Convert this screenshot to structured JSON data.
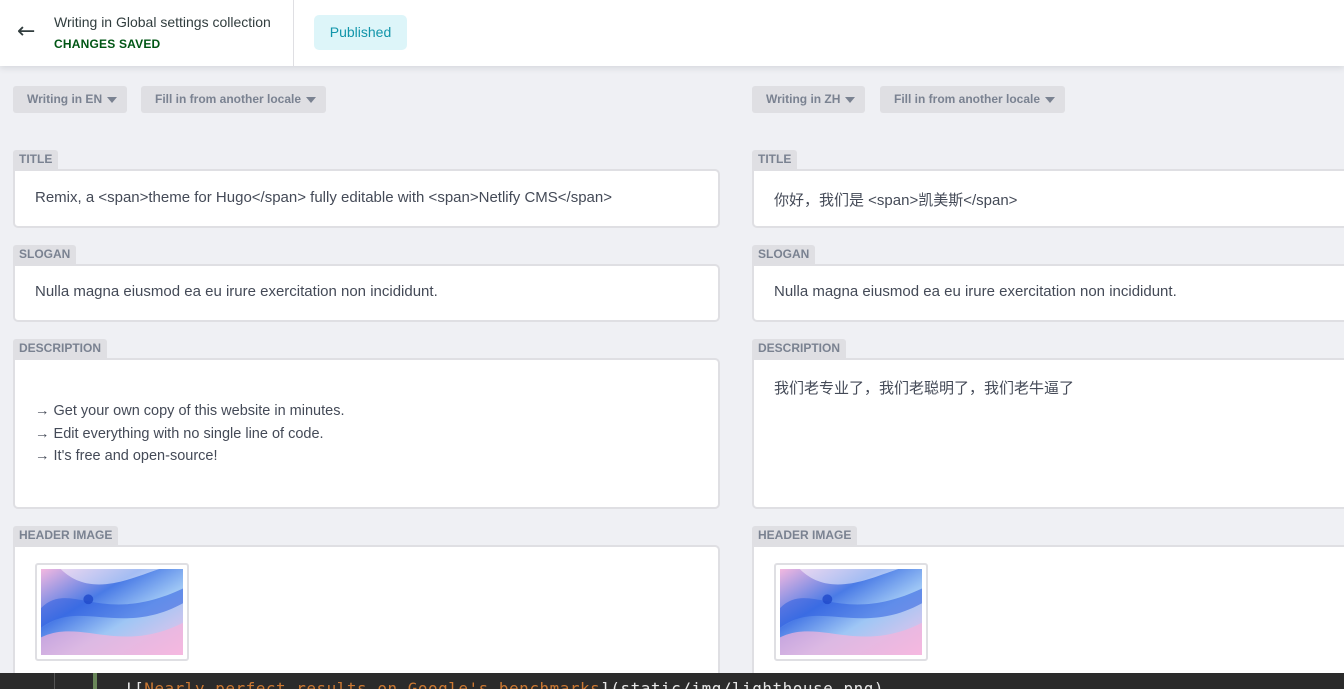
{
  "topbar": {
    "back_icon": "arrow-left-icon",
    "back_arrow": "←",
    "collection_title": "Writing in Global settings collection",
    "status_text": "CHANGES SAVED",
    "published_label": "Published"
  },
  "left": {
    "locale_label": "Writing in EN",
    "fill_label": "Fill in from another locale",
    "title_label": "TITLE",
    "title_value": "Remix, a <span>theme for Hugo</span> fully editable with <span>Netlify CMS</span>",
    "slogan_label": "SLOGAN",
    "slogan_value": "Nulla magna eiusmod ea eu irure exercitation non incididunt.",
    "description_label": "DESCRIPTION",
    "description_lines": [
      "→ Get your own copy of this website in minutes.",
      "→ Edit everything with no single line of code.",
      "→ It's free and open-source!"
    ],
    "header_image_label": "HEADER IMAGE"
  },
  "right": {
    "locale_label": "Writing in ZH",
    "fill_label": "Fill in from another locale",
    "title_label": "TITLE",
    "title_value": "你好，我们是 <span>凯美斯</span>",
    "slogan_label": "SLOGAN",
    "slogan_value": "Nulla magna eiusmod ea eu irure exercitation non incididunt.",
    "description_label": "DESCRIPTION",
    "description_value": "我们老专业了，我们老聪明了，我们老牛逼了",
    "header_image_label": "HEADER IMAGE"
  },
  "code_overlay": {
    "prefix": "![",
    "link_text": "Nearly perfect results on Google's benchmarks",
    "suffix": "](static/img/lighthouse.png)"
  },
  "colors": {
    "accent": "#1195aa",
    "saved_green": "#005614",
    "label_bg": "#dfdfe3",
    "text": "#444a57"
  }
}
